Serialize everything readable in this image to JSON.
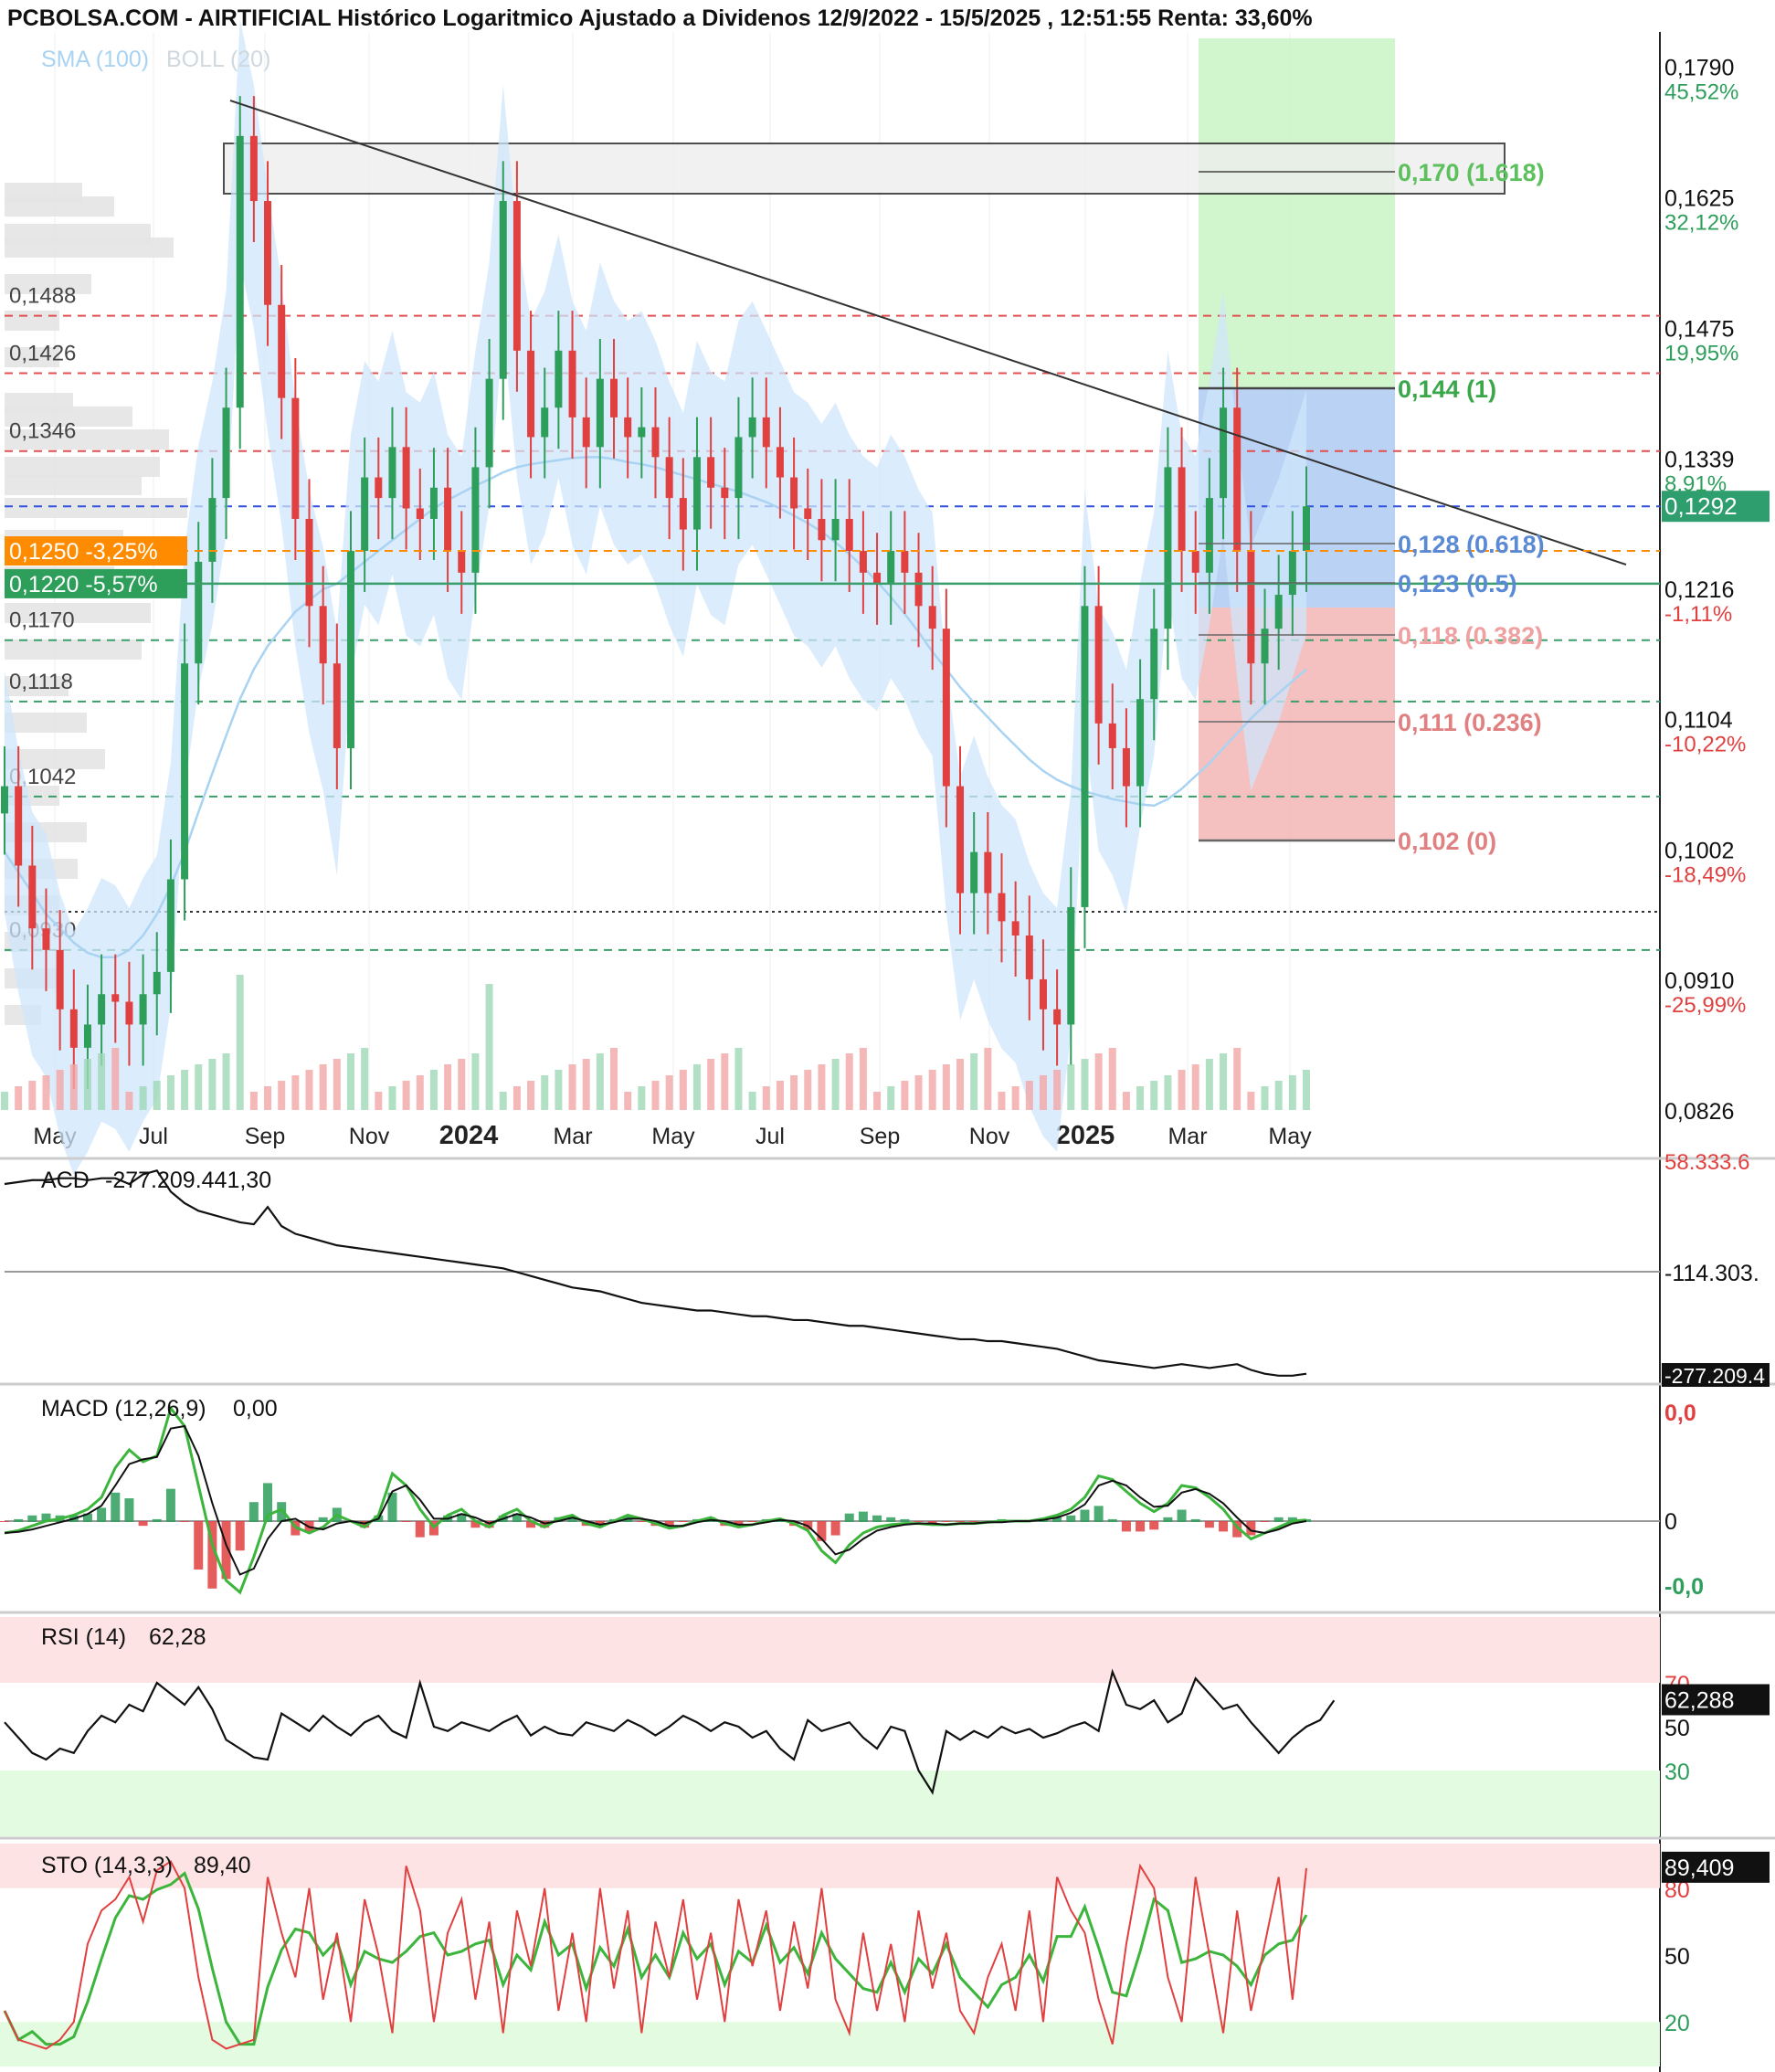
{
  "title": "PCBOLSA.COM - AIRTIFICIAL Histórico Logaritmico Ajustado a Dividenos 12/9/2022 - 15/5/2025 , 12:51:55 Renta: 33,60%",
  "colors": {
    "up": "#2e9e5b",
    "down": "#e0403f",
    "band": "#cfe6fb",
    "sma": "#a9d3f2",
    "red_line": "#e05050",
    "green_line": "#3a9e6a",
    "blue_line": "#3050e0",
    "orange": "#ff8c00"
  },
  "chart_data": [
    {
      "type": "line",
      "panel": "price",
      "legend": [
        "SMA (100)",
        "BOLL (20)"
      ],
      "scale": "log",
      "ylim": [
        0.0826,
        0.183
      ],
      "x_ticks": [
        "May",
        "Jul",
        "Sep",
        "Nov",
        "2024",
        "Mar",
        "May",
        "Jul",
        "Sep",
        "Nov",
        "2025",
        "Mar",
        "May"
      ],
      "right_axis": [
        {
          "price": "0,1790",
          "pct": "45,52%",
          "v": 0.179,
          "pct_color": "#2e9e5b"
        },
        {
          "price": "0,1625",
          "pct": "32,12%",
          "v": 0.1625,
          "pct_color": "#2e9e5b"
        },
        {
          "price": "0,1475",
          "pct": "19,95%",
          "v": 0.1475,
          "pct_color": "#2e9e5b"
        },
        {
          "price": "0,1339",
          "pct": "8,91%",
          "v": 0.1339,
          "pct_color": "#2e9e5b"
        },
        {
          "price": "0,1216",
          "pct": "-1,11%",
          "v": 0.1216,
          "pct_color": "#e0403f"
        },
        {
          "price": "0,1104",
          "pct": "-10,22%",
          "v": 0.1104,
          "pct_color": "#e0403f"
        },
        {
          "price": "0,1002",
          "pct": "-18,49%",
          "v": 0.1002,
          "pct_color": "#e0403f"
        },
        {
          "price": "0,0910",
          "pct": "-25,99%",
          "v": 0.091,
          "pct_color": "#e0403f"
        },
        {
          "price": "0,0826",
          "pct": "",
          "v": 0.0826,
          "pct_color": "#e0403f"
        }
      ],
      "current_price": "0,1292",
      "current_value": 0.1292,
      "levels": [
        {
          "label": "0,1488",
          "v": 0.1488,
          "color": "#e05050"
        },
        {
          "label": "0,1426",
          "v": 0.1426,
          "color": "#e05050"
        },
        {
          "label": "0,1346",
          "v": 0.1346,
          "color": "#e05050"
        },
        {
          "label": "0,1170",
          "v": 0.117,
          "color": "#3a9e6a"
        },
        {
          "label": "0,1118",
          "v": 0.1118,
          "color": "#3a9e6a"
        },
        {
          "label": "0,1042",
          "v": 0.1042,
          "color": "#3a9e6a"
        },
        {
          "label": "0,0930",
          "v": 0.093,
          "color": "#3a9e6a"
        }
      ],
      "tags": [
        {
          "label": "0,1250  -3,25%",
          "v": 0.125,
          "color": "#ff8c00"
        },
        {
          "label": "0,1220  -5,57%",
          "v": 0.122,
          "color": "#2e9e5b"
        }
      ],
      "fib_levels": [
        {
          "label": "0,170 (1.618)",
          "v": 0.17,
          "color": "#5cc05c"
        },
        {
          "label": "0,144 (1)",
          "v": 0.144,
          "color": "#3aa84a"
        },
        {
          "label": "0,128 (0.618)",
          "v": 0.128,
          "color": "#5a8ad6"
        },
        {
          "label": "0,123 (0.5)",
          "v": 0.123,
          "color": "#5a8ad6"
        },
        {
          "label": "0,118 (0.382)",
          "v": 0.118,
          "color": "#f0a0a0"
        },
        {
          "label": "0,111 (0.236)",
          "v": 0.111,
          "color": "#e08080"
        },
        {
          "label": "0,102 (0)",
          "v": 0.102,
          "color": "#e08080"
        }
      ],
      "series": [
        {
          "values": [
            0.105,
            0.099,
            0.0945,
            0.093,
            0.089,
            0.0865,
            0.088,
            0.09,
            0.0895,
            0.088,
            0.09,
            0.0915,
            0.098,
            0.115,
            0.124,
            0.13,
            0.139,
            0.17,
            0.162,
            0.15,
            0.14,
            0.128,
            0.12,
            0.115,
            0.108,
            0.125,
            0.132,
            0.13,
            0.135,
            0.129,
            0.128,
            0.131,
            0.125,
            0.123,
            0.133,
            0.142,
            0.162,
            0.145,
            0.136,
            0.139,
            0.145,
            0.138,
            0.135,
            0.142,
            0.138,
            0.136,
            0.137,
            0.134,
            0.13,
            0.127,
            0.134,
            0.131,
            0.13,
            0.136,
            0.138,
            0.135,
            0.132,
            0.129,
            0.128,
            0.126,
            0.128,
            0.125,
            0.123,
            0.122,
            0.125,
            0.123,
            0.12,
            0.118,
            0.105,
            0.097,
            0.1,
            0.097,
            0.095,
            0.094,
            0.091,
            0.089,
            0.088,
            0.096,
            0.12,
            0.11,
            0.108,
            0.105,
            0.112,
            0.118,
            0.133,
            0.125,
            0.123,
            0.13,
            0.139,
            0.125,
            0.115,
            0.118,
            0.121,
            0.125,
            0.1292
          ]
        },
        {
          "values": [
            0.1,
            0.0985,
            0.097,
            0.0955,
            0.0945,
            0.0935,
            0.0928,
            0.0925,
            0.0925,
            0.093,
            0.094,
            0.0955,
            0.0975,
            0.1,
            0.103,
            0.106,
            0.109,
            0.112,
            0.1145,
            0.1165,
            0.118,
            0.1195,
            0.1205,
            0.1215,
            0.122,
            0.123,
            0.124,
            0.125,
            0.126,
            0.127,
            0.128,
            0.129,
            0.1298,
            0.1305,
            0.1312,
            0.1318,
            0.1325,
            0.133,
            0.1333,
            0.1335,
            0.1337,
            0.1339,
            0.134,
            0.134,
            0.1338,
            0.1335,
            0.1333,
            0.133,
            0.1326,
            0.1322,
            0.1318,
            0.1314,
            0.131,
            0.1306,
            0.1301,
            0.1296,
            0.129,
            0.1283,
            0.1276,
            0.1268,
            0.1258,
            0.1247,
            0.1235,
            0.1222,
            0.1208,
            0.1193,
            0.1177,
            0.116,
            0.1145,
            0.113,
            0.1117,
            0.1105,
            0.1093,
            0.1082,
            0.1071,
            0.1062,
            0.1055,
            0.105,
            0.1046,
            0.1043,
            0.104,
            0.1038,
            0.1036,
            0.1035,
            0.104,
            0.1048,
            0.1058,
            0.1068,
            0.108,
            0.1092,
            0.1104,
            0.1115,
            0.1125,
            0.1135,
            0.1145
          ]
        }
      ]
    },
    {
      "type": "line",
      "panel": "acd",
      "label": "ACD",
      "value": "-277.209.441,30",
      "axis_top": "58.333.6",
      "axis_mid": "-114.303.",
      "axis_bot": "-277.209.4",
      "values": [
        0.9,
        0.91,
        0.92,
        0.92,
        0.93,
        0.93,
        0.92,
        0.93,
        0.93,
        0.9,
        0.95,
        0.97,
        0.86,
        0.8,
        0.76,
        0.74,
        0.72,
        0.7,
        0.69,
        0.78,
        0.68,
        0.64,
        0.62,
        0.6,
        0.58,
        0.57,
        0.56,
        0.55,
        0.54,
        0.53,
        0.52,
        0.51,
        0.5,
        0.49,
        0.48,
        0.47,
        0.46,
        0.44,
        0.42,
        0.4,
        0.38,
        0.36,
        0.35,
        0.34,
        0.32,
        0.3,
        0.28,
        0.27,
        0.26,
        0.25,
        0.24,
        0.24,
        0.23,
        0.22,
        0.21,
        0.21,
        0.2,
        0.19,
        0.19,
        0.18,
        0.17,
        0.16,
        0.16,
        0.15,
        0.14,
        0.13,
        0.12,
        0.11,
        0.1,
        0.09,
        0.09,
        0.08,
        0.08,
        0.07,
        0.06,
        0.05,
        0.04,
        0.02,
        0.0,
        -0.02,
        -0.03,
        -0.04,
        -0.05,
        -0.06,
        -0.05,
        -0.04,
        -0.05,
        -0.06,
        -0.05,
        -0.04,
        -0.07,
        -0.09,
        -0.1,
        -0.1,
        -0.09
      ]
    },
    {
      "type": "line",
      "panel": "macd",
      "label": "MACD (12,26,9)",
      "value": "0,00",
      "axis_labels": [
        "0,0",
        "0",
        "-0,0"
      ],
      "macd": [
        -0.1,
        -0.08,
        -0.04,
        0.0,
        0.02,
        0.05,
        0.1,
        0.2,
        0.45,
        0.6,
        0.5,
        0.55,
        0.95,
        0.8,
        0.3,
        -0.2,
        -0.5,
        -0.6,
        -0.3,
        0.05,
        0.1,
        -0.05,
        -0.1,
        -0.05,
        0.05,
        0.0,
        -0.05,
        0.05,
        0.4,
        0.3,
        0.1,
        -0.05,
        0.05,
        0.1,
        0.0,
        -0.05,
        0.05,
        0.1,
        0.0,
        -0.05,
        0.02,
        0.05,
        -0.02,
        -0.05,
        0.0,
        0.05,
        0.02,
        -0.02,
        -0.06,
        -0.04,
        0.0,
        0.03,
        -0.02,
        -0.05,
        -0.03,
        0.0,
        0.02,
        -0.02,
        -0.08,
        -0.25,
        -0.35,
        -0.2,
        -0.1,
        -0.05,
        -0.03,
        -0.02,
        -0.02,
        -0.03,
        -0.03,
        -0.02,
        -0.02,
        -0.01,
        0.0,
        0.0,
        0.0,
        0.02,
        0.05,
        0.1,
        0.2,
        0.38,
        0.35,
        0.25,
        0.15,
        0.08,
        0.15,
        0.3,
        0.28,
        0.2,
        0.1,
        -0.05,
        -0.15,
        -0.1,
        -0.05,
        0.0,
        0.01
      ],
      "signal": [
        -0.1,
        -0.09,
        -0.07,
        -0.04,
        -0.01,
        0.02,
        0.06,
        0.13,
        0.3,
        0.48,
        0.52,
        0.54,
        0.78,
        0.8,
        0.55,
        0.15,
        -0.2,
        -0.45,
        -0.4,
        -0.15,
        0.0,
        0.02,
        -0.05,
        -0.07,
        -0.02,
        0.0,
        -0.02,
        0.02,
        0.25,
        0.3,
        0.18,
        0.02,
        0.02,
        0.06,
        0.03,
        -0.02,
        0.02,
        0.06,
        0.03,
        -0.02,
        0.0,
        0.03,
        0.0,
        -0.03,
        -0.01,
        0.02,
        0.02,
        0.0,
        -0.04,
        -0.04,
        -0.01,
        0.01,
        0.0,
        -0.03,
        -0.03,
        -0.01,
        0.01,
        0.0,
        -0.04,
        -0.15,
        -0.28,
        -0.24,
        -0.15,
        -0.08,
        -0.05,
        -0.03,
        -0.02,
        -0.02,
        -0.03,
        -0.02,
        -0.02,
        -0.01,
        -0.01,
        0.0,
        0.0,
        0.01,
        0.03,
        0.07,
        0.14,
        0.3,
        0.34,
        0.3,
        0.2,
        0.12,
        0.13,
        0.24,
        0.27,
        0.23,
        0.15,
        0.03,
        -0.08,
        -0.1,
        -0.07,
        -0.02,
        0.0
      ]
    },
    {
      "type": "line",
      "panel": "rsi",
      "label": "RSI (14)",
      "value": "62,28",
      "current": "62,288",
      "axis_labels": [
        "70",
        "50",
        "30"
      ],
      "ylim": [
        0,
        100
      ],
      "values": [
        52,
        45,
        38,
        35,
        40,
        38,
        48,
        55,
        52,
        60,
        57,
        70,
        65,
        60,
        68,
        58,
        44,
        40,
        36,
        35,
        56,
        52,
        48,
        55,
        50,
        46,
        52,
        55,
        48,
        45,
        70,
        50,
        48,
        52,
        50,
        48,
        52,
        55,
        46,
        50,
        47,
        46,
        52,
        50,
        48,
        53,
        50,
        46,
        50,
        55,
        52,
        48,
        52,
        50,
        45,
        48,
        40,
        35,
        53,
        48,
        50,
        52,
        45,
        40,
        50,
        48,
        30,
        20,
        48,
        44,
        48,
        45,
        50,
        47,
        49,
        45,
        47,
        50,
        52,
        48,
        75,
        60,
        58,
        62,
        52,
        56,
        72,
        65,
        58,
        60,
        52,
        45,
        38,
        45,
        50,
        53,
        62
      ]
    },
    {
      "type": "line",
      "panel": "sto",
      "label": "STO (14,3,3)",
      "value": "89,40",
      "current": "89,409",
      "axis_labels": [
        "80",
        "50",
        "20"
      ],
      "ylim": [
        0,
        100
      ],
      "values": [
        25,
        12,
        10,
        8,
        12,
        20,
        55,
        70,
        75,
        85,
        65,
        88,
        92,
        80,
        40,
        12,
        8,
        10,
        12,
        85,
        60,
        40,
        80,
        30,
        60,
        20,
        75,
        50,
        15,
        90,
        70,
        20,
        60,
        75,
        30,
        65,
        15,
        70,
        45,
        80,
        25,
        60,
        20,
        80,
        35,
        70,
        15,
        65,
        40,
        75,
        30,
        60,
        20,
        75,
        45,
        70,
        25,
        65,
        35,
        80,
        30,
        15,
        60,
        25,
        55,
        20,
        70,
        35,
        60,
        25,
        15,
        40,
        55,
        25,
        70,
        20,
        85,
        70,
        60,
        30,
        10,
        55,
        90,
        80,
        40,
        20,
        85,
        50,
        15,
        70,
        25,
        55,
        85,
        30,
        89
      ]
    }
  ]
}
